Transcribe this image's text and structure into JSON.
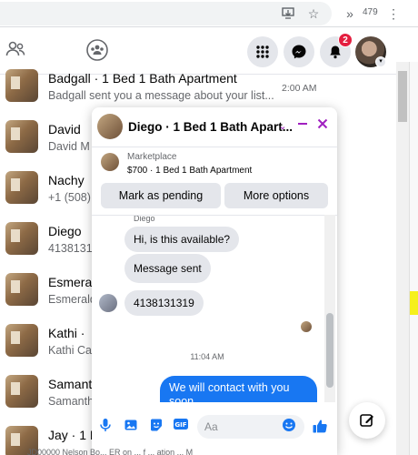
{
  "browser": {
    "extension_count": "479"
  },
  "header": {
    "notification_badge": "2"
  },
  "conversations": [
    {
      "name": "Badgall · 1 Bed 1 Bath Apartment",
      "snippet": "Badgall sent you a message about your list...",
      "time": "2:00 AM"
    },
    {
      "name": "David",
      "snippet": "David M",
      "time": ""
    },
    {
      "name": "Nachy",
      "snippet": "+1 (508)",
      "time": ""
    },
    {
      "name": "Diego",
      "snippet": "4138131",
      "time": ""
    },
    {
      "name": "Esmeral",
      "snippet": "Esmerald",
      "time": ""
    },
    {
      "name": "Kathi ·",
      "snippet": "Kathi Cas",
      "time": ""
    },
    {
      "name": "Samant",
      "snippet": "Samanth",
      "time": ""
    },
    {
      "name": "Jay · 1 B",
      "snippet": "",
      "time": ""
    }
  ],
  "chat": {
    "title": "Diego · 1 Bed 1 Bath Apart...",
    "marketplace_label": "Marketplace",
    "listing": "$700 · 1 Bed 1 Bath Apartment",
    "mark_pending": "Mark as pending",
    "more_options": "More options",
    "sender": "Diego",
    "messages": [
      {
        "text": "Hi, is this available?"
      },
      {
        "text": "Message sent"
      },
      {
        "text": "4138131319"
      }
    ],
    "timestamp": "11:04 AM",
    "outgoing": "We will contact with you soon",
    "input_placeholder": "Aa"
  },
  "footer_fragment": "JD00000    Nelson Bo...    ER on ... f ... ation ... M"
}
